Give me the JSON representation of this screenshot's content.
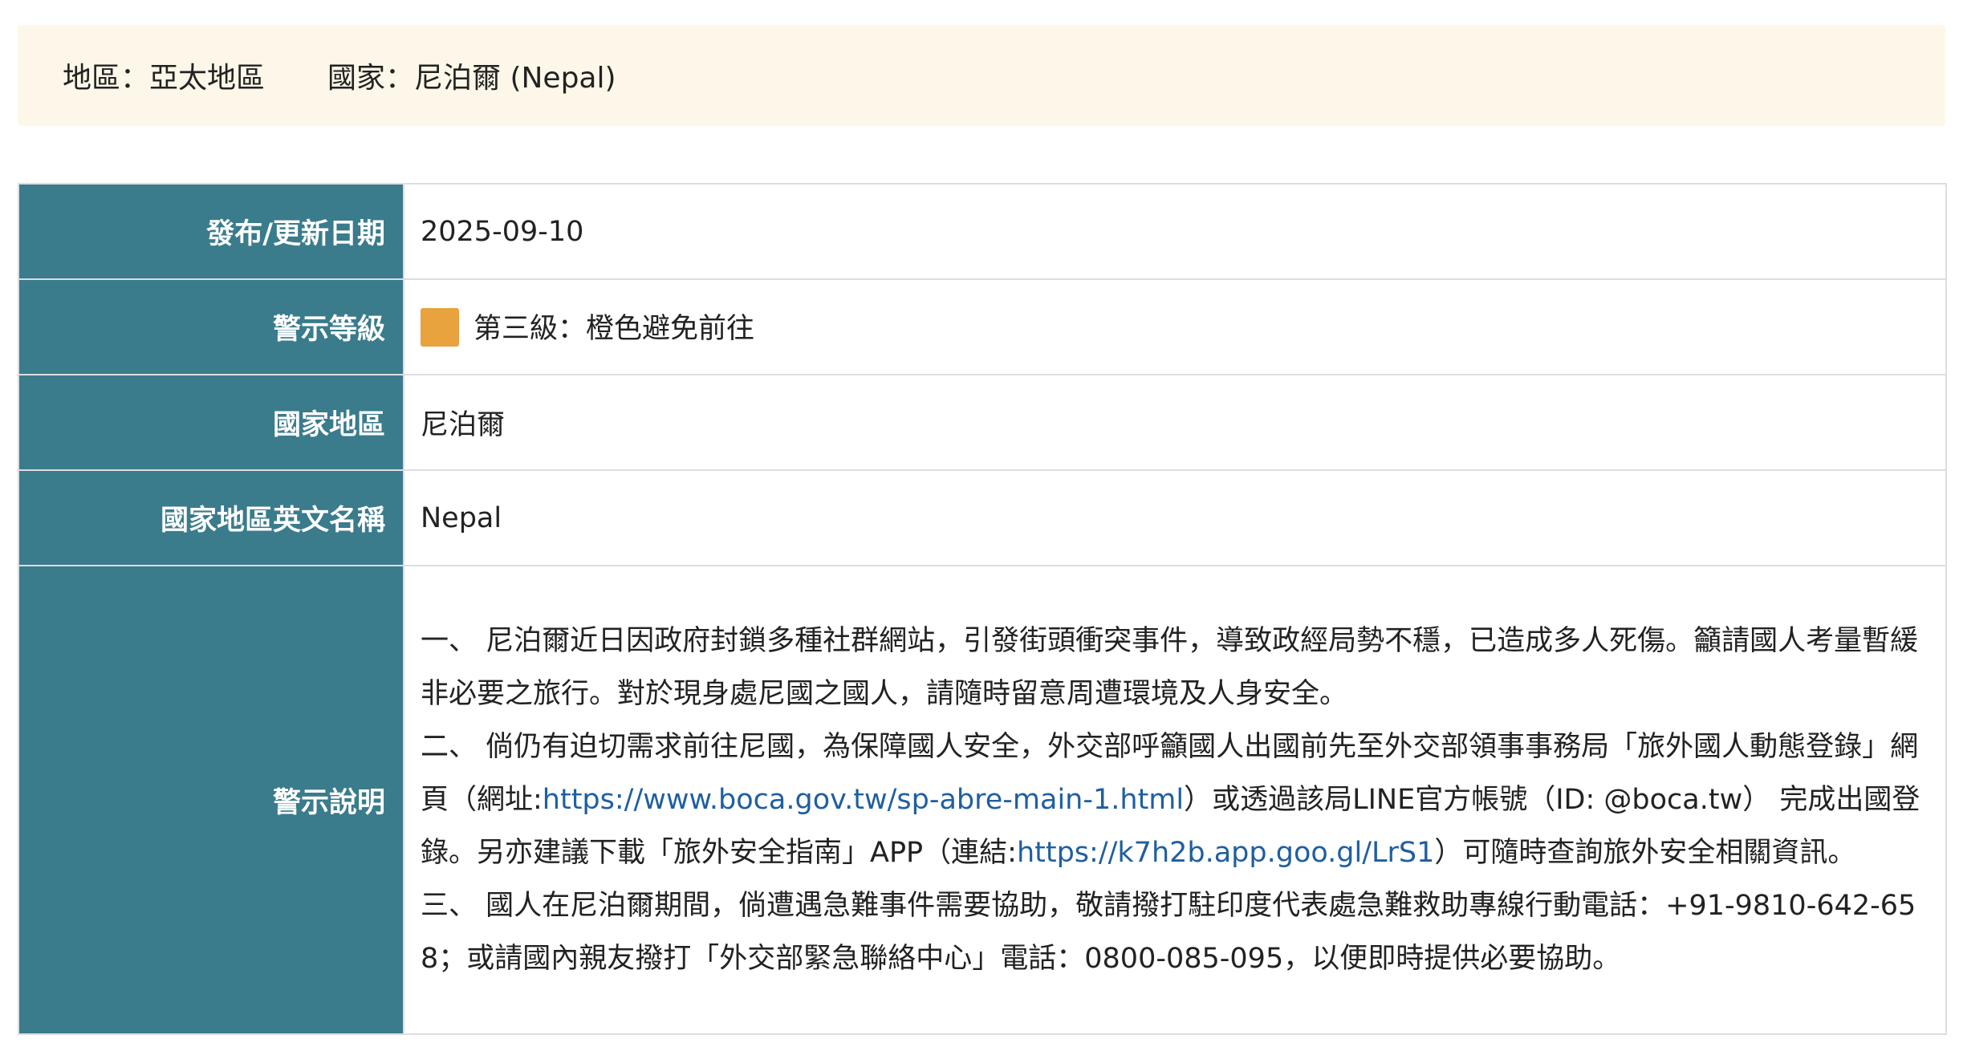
{
  "region_bar": {
    "region": "地區：亞太地區",
    "country": "國家：尼泊爾 (Nepal)"
  },
  "table": {
    "date_label": "發布/更新日期",
    "date_value": "2025-09-10",
    "level_label": "警示等級",
    "level_value": "第三級：橙色避免前往",
    "level_color": "#e8a23e",
    "country_label": "國家地區",
    "country_value": "尼泊爾",
    "country_en_label": "國家地區英文名稱",
    "country_en_value": "Nepal",
    "desc_label": "警示說明"
  },
  "description": {
    "p1": "一、 尼泊爾近日因政府封鎖多種社群網站，引發街頭衝突事件，導致政經局勢不穩，已造成多人死傷。籲請國人考量暫緩非必要之旅行。對於現身處尼國之國人，請隨時留意周遭環境及人身安全。",
    "p2_a": "二、 倘仍有迫切需求前往尼國，為保障國人安全，外交部呼籲國人出國前先至外交部領事事務局「旅外國人動態登錄」網頁（網址:",
    "p2_link1": "https://www.boca.gov.tw/sp-abre-main-1.html",
    "p2_b": "）或透過該局LINE官方帳號（ID: @boca.tw） 完成出國登錄。另亦建議下載「旅外安全指南」APP（連結:",
    "p2_link2": "https://k7h2b.app.goo.gl/LrS1",
    "p2_c": "）可隨時查詢旅外安全相關資訊。",
    "p3": "三、 國人在尼泊爾期間，倘遭遇急難事件需要協助，敬請撥打駐印度代表處急難救助專線行動電話：+91-9810-642-658；或請國內親友撥打「外交部緊急聯絡中心」電話：0800-085-095，以便即時提供必要協助。"
  }
}
